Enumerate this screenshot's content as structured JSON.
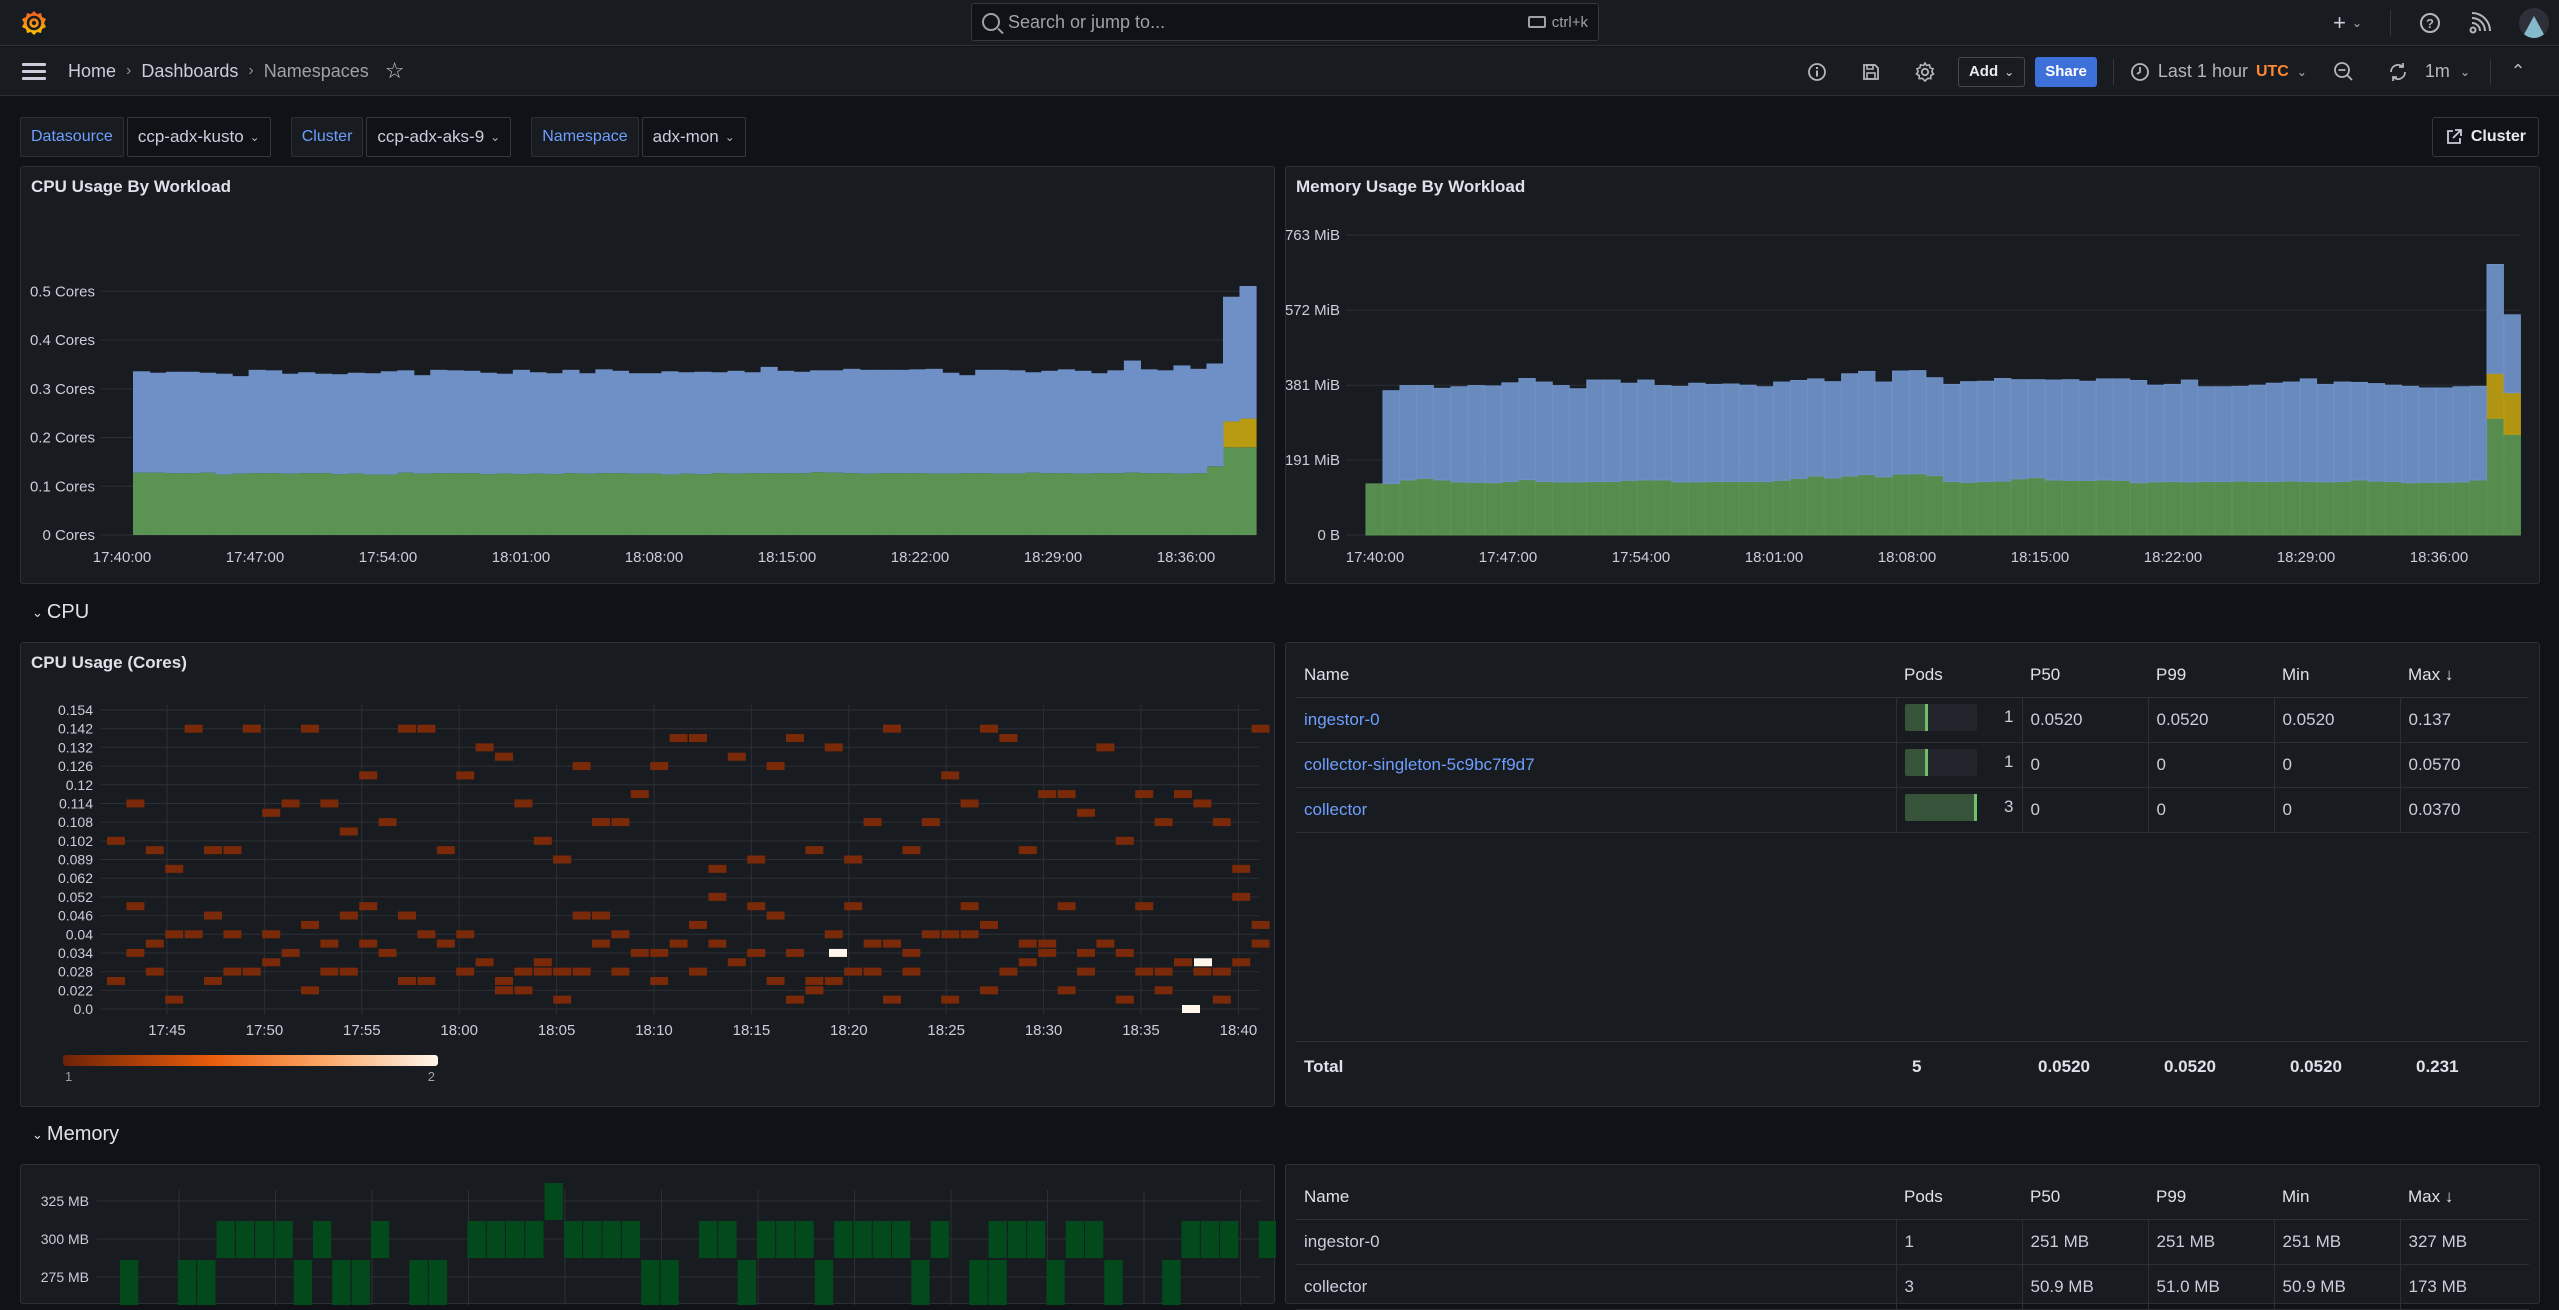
{
  "topbar": {
    "search_placeholder": "Search or jump to...",
    "search_shortcut": "ctrl+k",
    "new_label": "+"
  },
  "breadcrumb": {
    "items": [
      "Home",
      "Dashboards",
      "Namespaces"
    ]
  },
  "toolbar": {
    "add_label": "Add",
    "share_label": "Share",
    "time_range": "Last 1 hour",
    "timezone": "UTC",
    "refresh_interval": "1m"
  },
  "variables": [
    {
      "label": "Datasource",
      "value": "ccp-adx-kusto"
    },
    {
      "label": "Cluster",
      "value": "ccp-adx-aks-9"
    },
    {
      "label": "Namespace",
      "value": "adx-mon"
    }
  ],
  "link_button": "Cluster",
  "rows": {
    "cpu": "CPU",
    "memory": "Memory"
  },
  "colors": {
    "accent": "#3d71d9",
    "link": "#6e9fff",
    "utc": "#ff8833",
    "series_blue": "#6e90c6",
    "series_green": "#5a9352",
    "series_yellow": "#b99b12",
    "heat_low": "#7a2a08",
    "heat_high": "#fff6ec",
    "mem_heat": "#024a1b"
  },
  "chart_data": [
    {
      "id": "cpu-by-workload",
      "type": "area",
      "title": "CPU Usage By Workload",
      "stacked": true,
      "ylim": [
        0,
        0.55
      ],
      "yticks": [
        0,
        0.1,
        0.2,
        0.3,
        0.4,
        0.5
      ],
      "ytick_labels": [
        "0 Cores",
        "0.1 Cores",
        "0.2 Cores",
        "0.3 Cores",
        "0.4 Cores",
        "0.5 Cores"
      ],
      "x_tick_labels": [
        "17:40:00",
        "17:47:00",
        "17:54:00",
        "18:01:00",
        "18:08:00",
        "18:15:00",
        "18:22:00",
        "18:29:00",
        "18:36:00"
      ],
      "series": [
        {
          "name": "collector",
          "color": "#5a9352",
          "values": [
            0.128,
            0.128,
            0.127,
            0.127,
            0.128,
            0.124,
            0.126,
            0.127,
            0.127,
            0.126,
            0.127,
            0.127,
            0.125,
            0.126,
            0.124,
            0.124,
            0.128,
            0.126,
            0.127,
            0.127,
            0.127,
            0.125,
            0.126,
            0.125,
            0.126,
            0.125,
            0.127,
            0.126,
            0.127,
            0.127,
            0.126,
            0.126,
            0.124,
            0.126,
            0.125,
            0.127,
            0.126,
            0.127,
            0.127,
            0.127,
            0.127,
            0.129,
            0.128,
            0.127,
            0.126,
            0.127,
            0.127,
            0.127,
            0.126,
            0.126,
            0.127,
            0.127,
            0.126,
            0.126,
            0.128,
            0.127,
            0.127,
            0.126,
            0.127,
            0.127,
            0.128,
            0.127,
            0.127,
            0.126,
            0.127,
            0.141,
            0.18,
            0.18
          ]
        },
        {
          "name": "collector-singleton",
          "color": "#b99b12",
          "values": [
            0,
            0,
            0,
            0,
            0,
            0,
            0,
            0,
            0,
            0,
            0,
            0,
            0,
            0,
            0,
            0,
            0,
            0,
            0,
            0,
            0,
            0,
            0,
            0,
            0,
            0,
            0,
            0,
            0,
            0,
            0,
            0,
            0,
            0,
            0,
            0,
            0,
            0,
            0,
            0,
            0,
            0,
            0,
            0,
            0,
            0,
            0,
            0,
            0,
            0,
            0,
            0,
            0,
            0,
            0,
            0,
            0,
            0,
            0,
            0,
            0,
            0,
            0,
            0,
            0,
            0,
            0.053,
            0.059
          ]
        },
        {
          "name": "ingestor-0",
          "color": "#6e90c6",
          "values": [
            0.208,
            0.205,
            0.208,
            0.208,
            0.205,
            0.207,
            0.2,
            0.212,
            0.211,
            0.205,
            0.207,
            0.204,
            0.205,
            0.207,
            0.208,
            0.212,
            0.21,
            0.202,
            0.212,
            0.211,
            0.21,
            0.208,
            0.205,
            0.214,
            0.208,
            0.207,
            0.212,
            0.206,
            0.213,
            0.21,
            0.206,
            0.206,
            0.212,
            0.208,
            0.21,
            0.207,
            0.211,
            0.207,
            0.218,
            0.21,
            0.208,
            0.209,
            0.21,
            0.214,
            0.213,
            0.212,
            0.212,
            0.213,
            0.215,
            0.207,
            0.201,
            0.212,
            0.213,
            0.212,
            0.206,
            0.21,
            0.213,
            0.211,
            0.205,
            0.211,
            0.23,
            0.213,
            0.211,
            0.222,
            0.214,
            0.211,
            0.256,
            0.272
          ]
        }
      ]
    },
    {
      "id": "memory-by-workload",
      "type": "bar",
      "title": "Memory Usage By Workload",
      "stacked": true,
      "ylim": [
        0,
        763
      ],
      "yticks": [
        0,
        191,
        381,
        572,
        763
      ],
      "ytick_labels": [
        "0 B",
        "191 MiB",
        "381 MiB",
        "572 MiB",
        "763 MiB"
      ],
      "x_tick_labels": [
        "17:40:00",
        "17:47:00",
        "17:54:00",
        "18:01:00",
        "18:08:00",
        "18:15:00",
        "18:22:00",
        "18:29:00",
        "18:36:00"
      ],
      "series": [
        {
          "name": "collector",
          "color": "#5a9352",
          "values": [
            130,
            131,
            140,
            144,
            140,
            135,
            134,
            133,
            136,
            141,
            136,
            135,
            135,
            136,
            136,
            139,
            140,
            140,
            135,
            135,
            136,
            136,
            136,
            136,
            139,
            144,
            150,
            145,
            150,
            154,
            148,
            155,
            156,
            151,
            136,
            134,
            136,
            137,
            143,
            146,
            140,
            139,
            139,
            140,
            139,
            133,
            135,
            136,
            135,
            136,
            136,
            137,
            136,
            136,
            137,
            136,
            135,
            136,
            140,
            137,
            136,
            133,
            134,
            134,
            135,
            140,
            297,
            256
          ]
        },
        {
          "name": "collector-singleton",
          "color": "#b99b12",
          "values": [
            0,
            0,
            0,
            0,
            0,
            0,
            0,
            0,
            0,
            0,
            0,
            0,
            0,
            0,
            0,
            0,
            0,
            0,
            0,
            0,
            0,
            0,
            0,
            0,
            0,
            0,
            0,
            0,
            0,
            0,
            0,
            0,
            0,
            0,
            0,
            0,
            0,
            0,
            0,
            0,
            0,
            0,
            0,
            0,
            0,
            0,
            0,
            0,
            0,
            0,
            0,
            0,
            0,
            0,
            0,
            0,
            0,
            0,
            0,
            0,
            0,
            0,
            0,
            0,
            0,
            0,
            114,
            106
          ]
        },
        {
          "name": "ingestor-0",
          "color": "#6e90c6",
          "values": [
            0,
            236,
            240,
            236,
            233,
            242,
            246,
            246,
            251,
            257,
            253,
            245,
            237,
            258,
            258,
            247,
            254,
            240,
            243,
            251,
            247,
            248,
            245,
            241,
            250,
            249,
            247,
            245,
            260,
            262,
            241,
            262,
            262,
            249,
            247,
            256,
            255,
            261,
            252,
            249,
            254,
            256,
            252,
            257,
            258,
            260,
            246,
            247,
            259,
            241,
            241,
            241,
            245,
            250,
            252,
            261,
            248,
            253,
            248,
            248,
            245,
            245,
            240,
            240,
            242,
            238,
            277,
            198
          ]
        }
      ]
    },
    {
      "id": "cpu-usage-heatmap",
      "type": "heatmap",
      "title": "CPU Usage (Cores)",
      "y_buckets": [
        "0.0",
        "0.022",
        "0.028",
        "0.034",
        "0.04",
        "0.046",
        "0.052",
        "0.062",
        "0.089",
        "0.102",
        "0.108",
        "0.114",
        "0.12",
        "0.126",
        "0.132",
        "0.142",
        "0.154"
      ],
      "x_tick_labels": [
        "17:45",
        "17:50",
        "17:55",
        "18:00",
        "18:05",
        "18:10",
        "18:15",
        "18:20",
        "18:25",
        "18:30",
        "18:35",
        "18:40"
      ],
      "legend": {
        "min": "1",
        "max": "2"
      },
      "high_cells": [
        [
          18.3,
          3
        ],
        [
          18.62,
          3.5
        ],
        [
          18.6,
          0
        ]
      ],
      "note": "most cells count=1 (dark orange), three cells count=2 (white)"
    },
    {
      "id": "memory-usage-heatmap",
      "type": "heatmap",
      "title": "",
      "y_tick_labels": [
        "325 MB",
        "300 MB",
        "275 MB"
      ]
    }
  ],
  "cpu_table": {
    "columns": [
      "Name",
      "Pods",
      "P50",
      "P99",
      "Min",
      "Max"
    ],
    "sort_column": "Max",
    "rows": [
      {
        "name": "ingestor-0",
        "pods": "1",
        "pods_fraction": 0.333,
        "p50": "0.0520",
        "p99": "0.0520",
        "min": "0.0520",
        "max": "0.137"
      },
      {
        "name": "collector-singleton-5c9bc7f9d7",
        "pods": "1",
        "pods_fraction": 0.333,
        "p50": "0",
        "p99": "0",
        "min": "0",
        "max": "0.0570"
      },
      {
        "name": "collector",
        "pods": "3",
        "pods_fraction": 1.0,
        "p50": "0",
        "p99": "0",
        "min": "0",
        "max": "0.0370"
      }
    ],
    "total": {
      "label": "Total",
      "pods": "5",
      "p50": "0.0520",
      "p99": "0.0520",
      "min": "0.0520",
      "max": "0.231"
    }
  },
  "memory_table": {
    "columns": [
      "Name",
      "Pods",
      "P50",
      "P99",
      "Min",
      "Max"
    ],
    "sort_column": "Max",
    "rows": [
      {
        "name": "ingestor-0",
        "pods": "1",
        "p50": "251 MB",
        "p99": "251 MB",
        "min": "251 MB",
        "max": "327 MB"
      },
      {
        "name": "collector",
        "pods": "3",
        "p50": "50.9 MB",
        "p99": "51.0 MB",
        "min": "50.9 MB",
        "max": "173 MB"
      }
    ]
  }
}
